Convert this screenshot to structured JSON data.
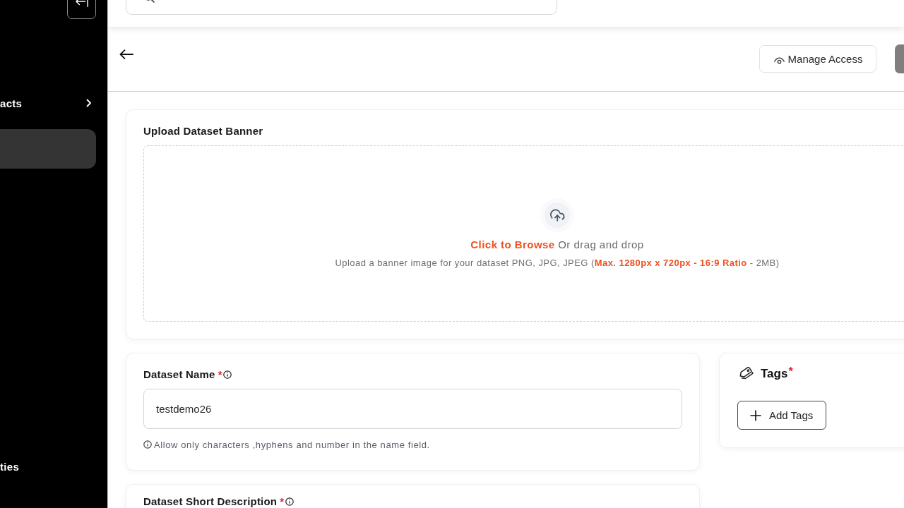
{
  "sidebar": {
    "items": [
      {
        "label": "acts",
        "selected": false,
        "expandable": true
      },
      {
        "selected": true,
        "expandable": false
      },
      {
        "label": "ties",
        "selected": false,
        "expandable": false
      }
    ]
  },
  "page_header": {
    "actions": [
      {
        "label": "Manage Access",
        "kind": "outline"
      },
      {
        "kind": "filled"
      }
    ]
  },
  "banner_card": {
    "title": "Upload Dataset Banner",
    "browse_link": "Click to Browse",
    "browse_rest": "Or drag and drop",
    "hint": "Upload a banner image for your dataset PNG, JPG, JPEG (**Max. 1280px x 720px - 16:9 Ratio** - 2MB)"
  },
  "name_card": {
    "label": "Dataset Name",
    "required_mark": "*",
    "value": "testdemo26",
    "hint": "Allow only characters ,hyphens and number in the name field."
  },
  "tags_card": {
    "title": "Tags",
    "required_mark": "*",
    "button": "Add Tags"
  },
  "description_card": {
    "label": "Dataset Short Description",
    "required_mark": "*"
  }
}
